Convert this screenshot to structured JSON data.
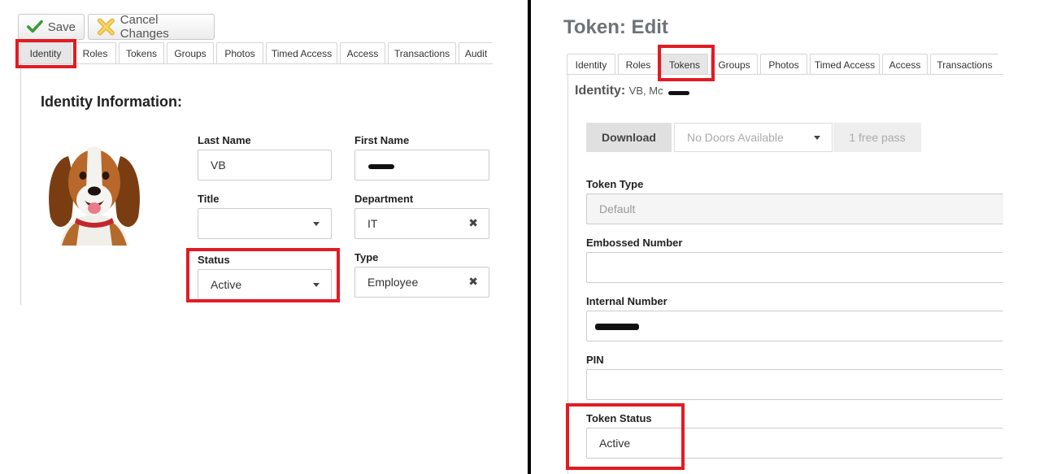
{
  "left": {
    "toolbar": {
      "save_label": "Save",
      "cancel_label": "Cancel Changes"
    },
    "tabs": [
      "Identity",
      "Roles",
      "Tokens",
      "Groups",
      "Photos",
      "Timed Access",
      "Access",
      "Transactions",
      "Audit"
    ],
    "active_tab": "Identity",
    "heading": "Identity Information:",
    "fields": {
      "last_name": {
        "label": "Last Name",
        "value": "VB"
      },
      "first_name": {
        "label": "First Name",
        "value": ""
      },
      "title": {
        "label": "Title",
        "value": ""
      },
      "department": {
        "label": "Department",
        "value": "IT"
      },
      "status": {
        "label": "Status",
        "value": "Active"
      },
      "type": {
        "label": "Type",
        "value": "Employee"
      }
    }
  },
  "right": {
    "title": "Token: Edit",
    "tabs": [
      "Identity",
      "Roles",
      "Tokens",
      "Groups",
      "Photos",
      "Timed Access",
      "Access",
      "Transactions"
    ],
    "active_tab": "Tokens",
    "identity": {
      "label": "Identity:",
      "value": "VB, Mc"
    },
    "actions": {
      "download": "Download",
      "doors_placeholder": "No Doors Available",
      "free_pass": "1 free pass"
    },
    "fields": {
      "token_type": {
        "label": "Token Type",
        "value": "Default"
      },
      "embossed_number": {
        "label": "Embossed Number",
        "value": ""
      },
      "internal_number": {
        "label": "Internal Number",
        "value": ""
      },
      "pin": {
        "label": "PIN",
        "value": ""
      },
      "token_status": {
        "label": "Token Status",
        "value": "Active"
      }
    }
  },
  "colors": {
    "highlight": "#e21b23",
    "divider": "#000000"
  }
}
